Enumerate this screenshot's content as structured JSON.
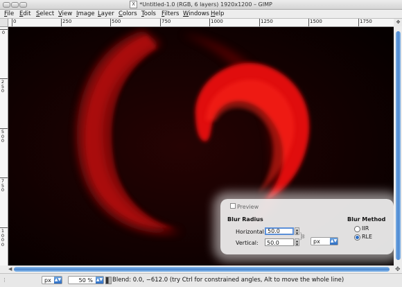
{
  "window": {
    "title": "*Untitled-1.0 (RGB, 6 layers) 1920x1200 – GIMP",
    "x_logo": "X"
  },
  "menu": [
    {
      "label": "File",
      "key": "F",
      "rest": "ile"
    },
    {
      "label": "Edit",
      "key": "E",
      "rest": "dit"
    },
    {
      "label": "Select",
      "key": "S",
      "rest": "elect"
    },
    {
      "label": "View",
      "key": "V",
      "rest": "iew"
    },
    {
      "label": "Image",
      "key": "I",
      "rest": "mage"
    },
    {
      "label": "Layer",
      "key": "L",
      "rest": "ayer"
    },
    {
      "label": "Colors",
      "key": "C",
      "rest": "olors"
    },
    {
      "label": "Tools",
      "key": "T",
      "rest": "ools"
    },
    {
      "label": "Filters",
      "key": "F",
      "rest": "ilters"
    },
    {
      "label": "Windows",
      "key": "W",
      "rest": "indows"
    },
    {
      "label": "Help",
      "key": "H",
      "rest": "elp"
    }
  ],
  "rulers": {
    "horizontal_labels": [
      "0",
      "250",
      "500",
      "750",
      "1000",
      "1250",
      "1500",
      "1750"
    ],
    "vertical_labels": [
      "0",
      "250",
      "500",
      "750",
      "1000"
    ]
  },
  "blur_dialog": {
    "preview_label": "Preview",
    "radius_title": "Blur Radius",
    "horizontal_label": "Horizontal:",
    "horizontal_value": "50.0",
    "vertical_label": "Vertical:",
    "vertical_value": "50.0",
    "unit": "px",
    "method_title": "Blur Method",
    "method_options": [
      "IIR",
      "RLE"
    ],
    "method_selected": "RLE"
  },
  "statusbar": {
    "unit": "px",
    "zoom": "50 %",
    "message": "Blend: 0.0, −612.0 (try Ctrl for constrained angles, Alt to move the whole line)"
  },
  "colors": {
    "selection_blue": "#4a86d0",
    "swirl_red": "#e00d0d",
    "canvas_dark": "#0a0101"
  }
}
